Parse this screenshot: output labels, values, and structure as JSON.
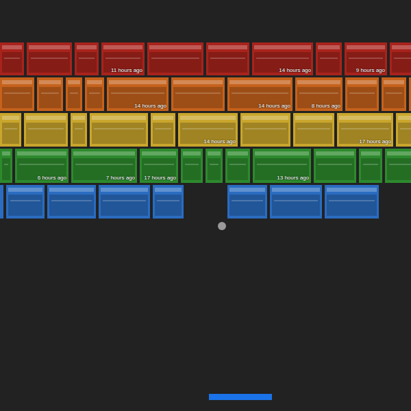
{
  "rows": [
    {
      "color": "#a8231c",
      "bricks": [
        {
          "broken": false
        },
        {
          "broken": false
        },
        {
          "broken": false
        },
        {
          "label": "11 hours ago",
          "broken": false
        },
        {
          "broken": false
        },
        {
          "broken": false
        },
        {
          "label": "14 hours ago",
          "broken": false
        },
        {
          "broken": false
        },
        {
          "label": "9 hours ago",
          "broken": false
        },
        {
          "broken": false
        }
      ]
    },
    {
      "color": "#c5621c",
      "bricks": [
        {
          "broken": false
        },
        {
          "broken": false
        },
        {
          "broken": false
        },
        {
          "broken": false
        },
        {
          "label": "14 hours ago",
          "broken": false
        },
        {
          "broken": false
        },
        {
          "label": "14 hours ago",
          "broken": false
        },
        {
          "label": "8 hours ago",
          "broken": false
        },
        {
          "broken": false
        },
        {
          "broken": false
        },
        {
          "broken": false
        }
      ]
    },
    {
      "color": "#c9a62c",
      "bricks": [
        {
          "broken": false
        },
        {
          "broken": false
        },
        {
          "broken": false
        },
        {
          "broken": false
        },
        {
          "broken": false
        },
        {
          "label": "14 hours ago",
          "broken": false
        },
        {
          "broken": false
        },
        {
          "broken": false
        },
        {
          "label": "17 hours ago",
          "broken": false
        },
        {
          "broken": false
        }
      ]
    },
    {
      "color": "#2d8a2d",
      "bricks": [
        {
          "broken": false
        },
        {
          "label": "6 hours ago",
          "broken": false
        },
        {
          "label": "7 hours ago",
          "broken": false
        },
        {
          "label": "17 hours ago",
          "broken": false
        },
        {
          "broken": false
        },
        {
          "broken": false
        },
        {
          "broken": false
        },
        {
          "label": "13 hours ago",
          "broken": false
        },
        {
          "broken": false
        },
        {
          "broken": false
        },
        {
          "broken": false
        }
      ]
    },
    {
      "color": "#2a6cc0",
      "bricks": [
        {
          "broken": false
        },
        {
          "broken": false
        },
        {
          "broken": false
        },
        {
          "broken": false
        },
        {
          "broken": false
        },
        {
          "broken": true
        },
        {
          "broken": false
        },
        {
          "broken": false
        },
        {
          "broken": false
        },
        {
          "broken": true
        }
      ]
    }
  ]
}
